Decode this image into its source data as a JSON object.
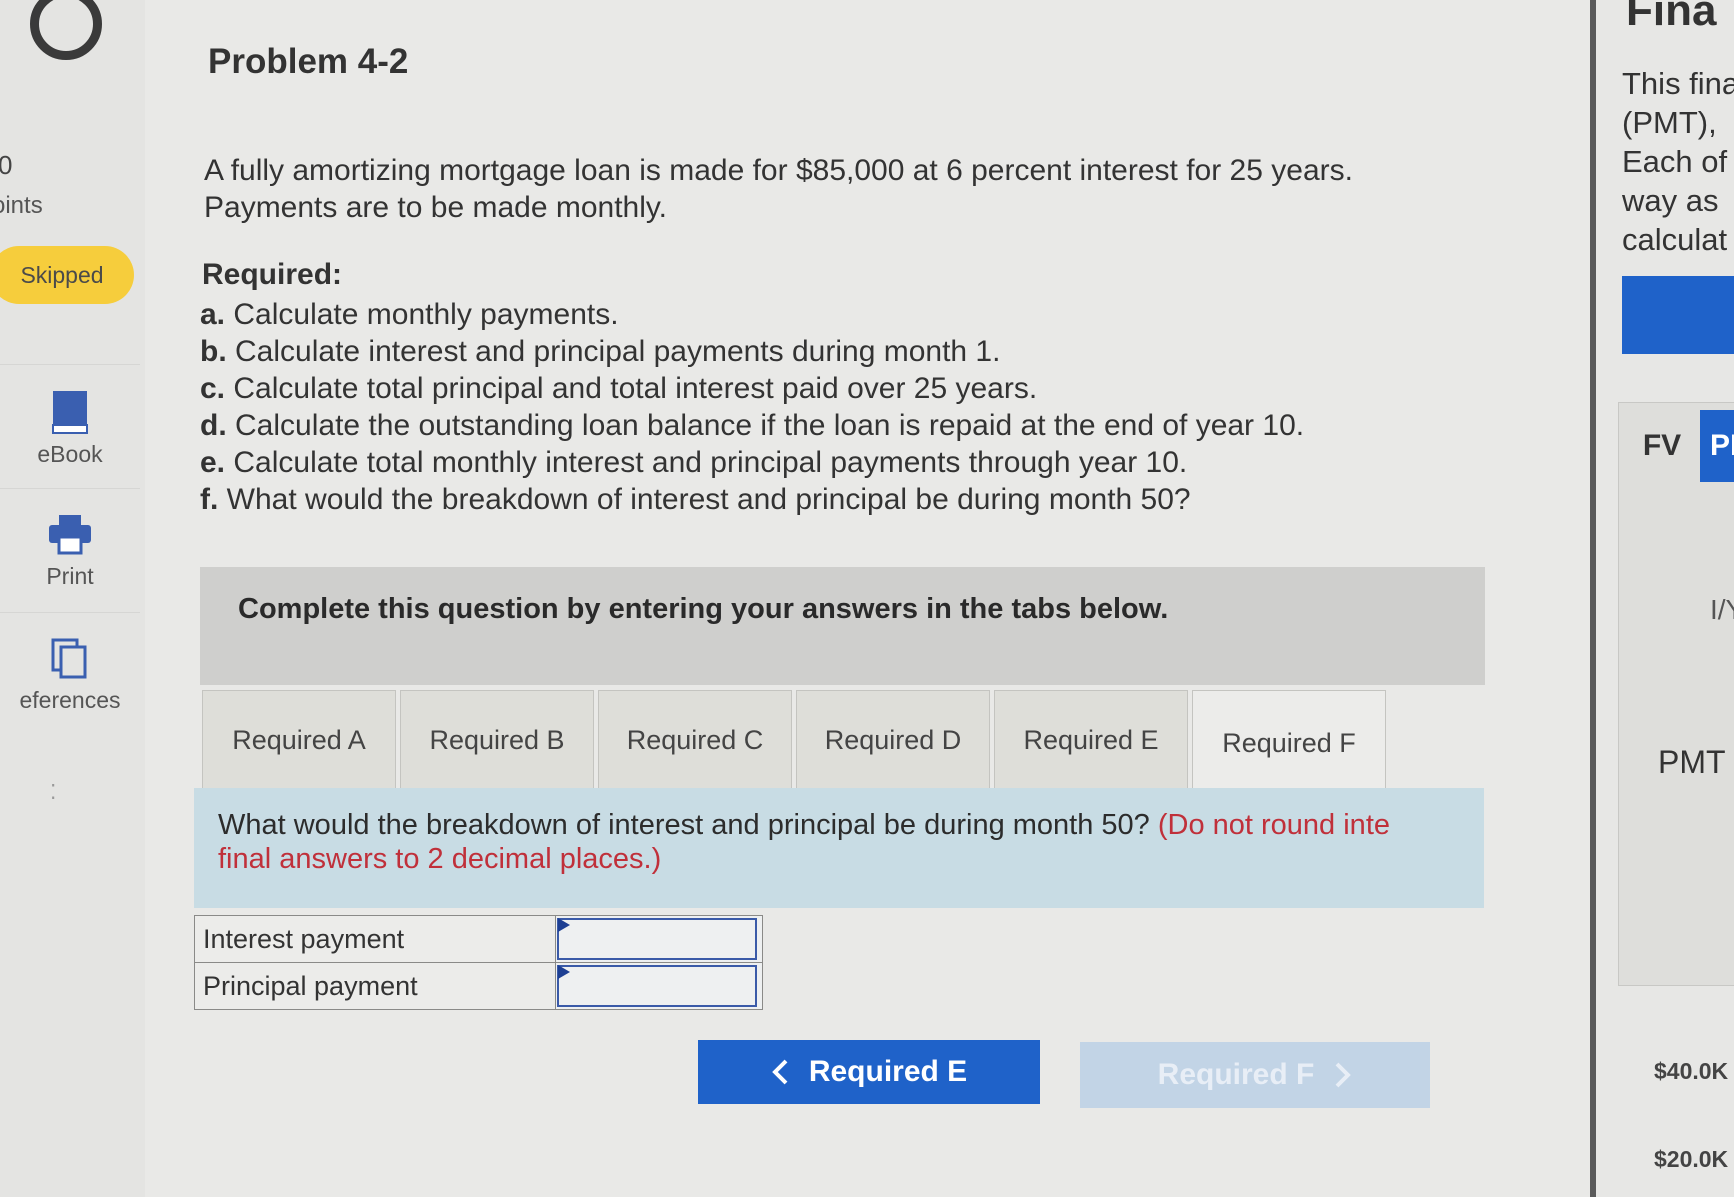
{
  "sidebar": {
    "points_value": "0",
    "points_label": "oints",
    "status_badge": "Skipped",
    "tools": [
      {
        "label": "eBook",
        "icon": "book-icon"
      },
      {
        "label": "Print",
        "icon": "printer-icon"
      },
      {
        "label": "eferences",
        "icon": "copy-icon"
      }
    ]
  },
  "problem": {
    "title": "Problem 4-2",
    "intro_line1": "A fully amortizing mortgage loan is made for $85,000 at 6 percent interest for 25 years.",
    "intro_line2": "Payments are to be made monthly.",
    "required_heading": "Required:",
    "requirements": [
      {
        "letter": "a.",
        "text": "Calculate monthly payments."
      },
      {
        "letter": "b.",
        "text": "Calculate interest and principal payments during month 1."
      },
      {
        "letter": "c.",
        "text": "Calculate total principal and total interest paid over 25 years."
      },
      {
        "letter": "d.",
        "text": "Calculate the outstanding loan balance if the loan is repaid at the end of year 10."
      },
      {
        "letter": "e.",
        "text": "Calculate total monthly interest and principal payments through year 10."
      },
      {
        "letter": "f.",
        "text": "What would the breakdown of interest and principal be during month 50?"
      }
    ]
  },
  "banner": {
    "text": "Complete this question by entering your answers in the tabs below."
  },
  "tabs": [
    {
      "label": "Required A",
      "active": false
    },
    {
      "label": "Required B",
      "active": false
    },
    {
      "label": "Required C",
      "active": false
    },
    {
      "label": "Required D",
      "active": false
    },
    {
      "label": "Required E",
      "active": false
    },
    {
      "label": "Required F",
      "active": true
    }
  ],
  "question": {
    "text": "What would the breakdown of interest and principal be during month 50?",
    "instruction_line1": "(Do not round inte",
    "instruction_line2": "final answers to 2 decimal places.)"
  },
  "answer_table": {
    "rows": [
      {
        "label": "Interest payment",
        "value": ""
      },
      {
        "label": "Principal payment",
        "value": ""
      }
    ]
  },
  "navigation": {
    "prev_label": "Required E",
    "next_label": "Required F"
  },
  "right_panel": {
    "title": "Fina",
    "lines": [
      "This fina",
      "(PMT),",
      "Each of",
      "way as",
      "calculat"
    ],
    "tab_fv": "FV",
    "tab_pmt": "PI",
    "label_iy": "I/Y",
    "label_pmt": "PMT",
    "axis_40": "$40.0K",
    "axis_20": "$20.0K"
  },
  "colors": {
    "accent_blue": "#1f62c9",
    "badge_yellow": "#f6cd3c",
    "instruction_red": "#c0303a",
    "question_panel": "#c8dce4"
  }
}
